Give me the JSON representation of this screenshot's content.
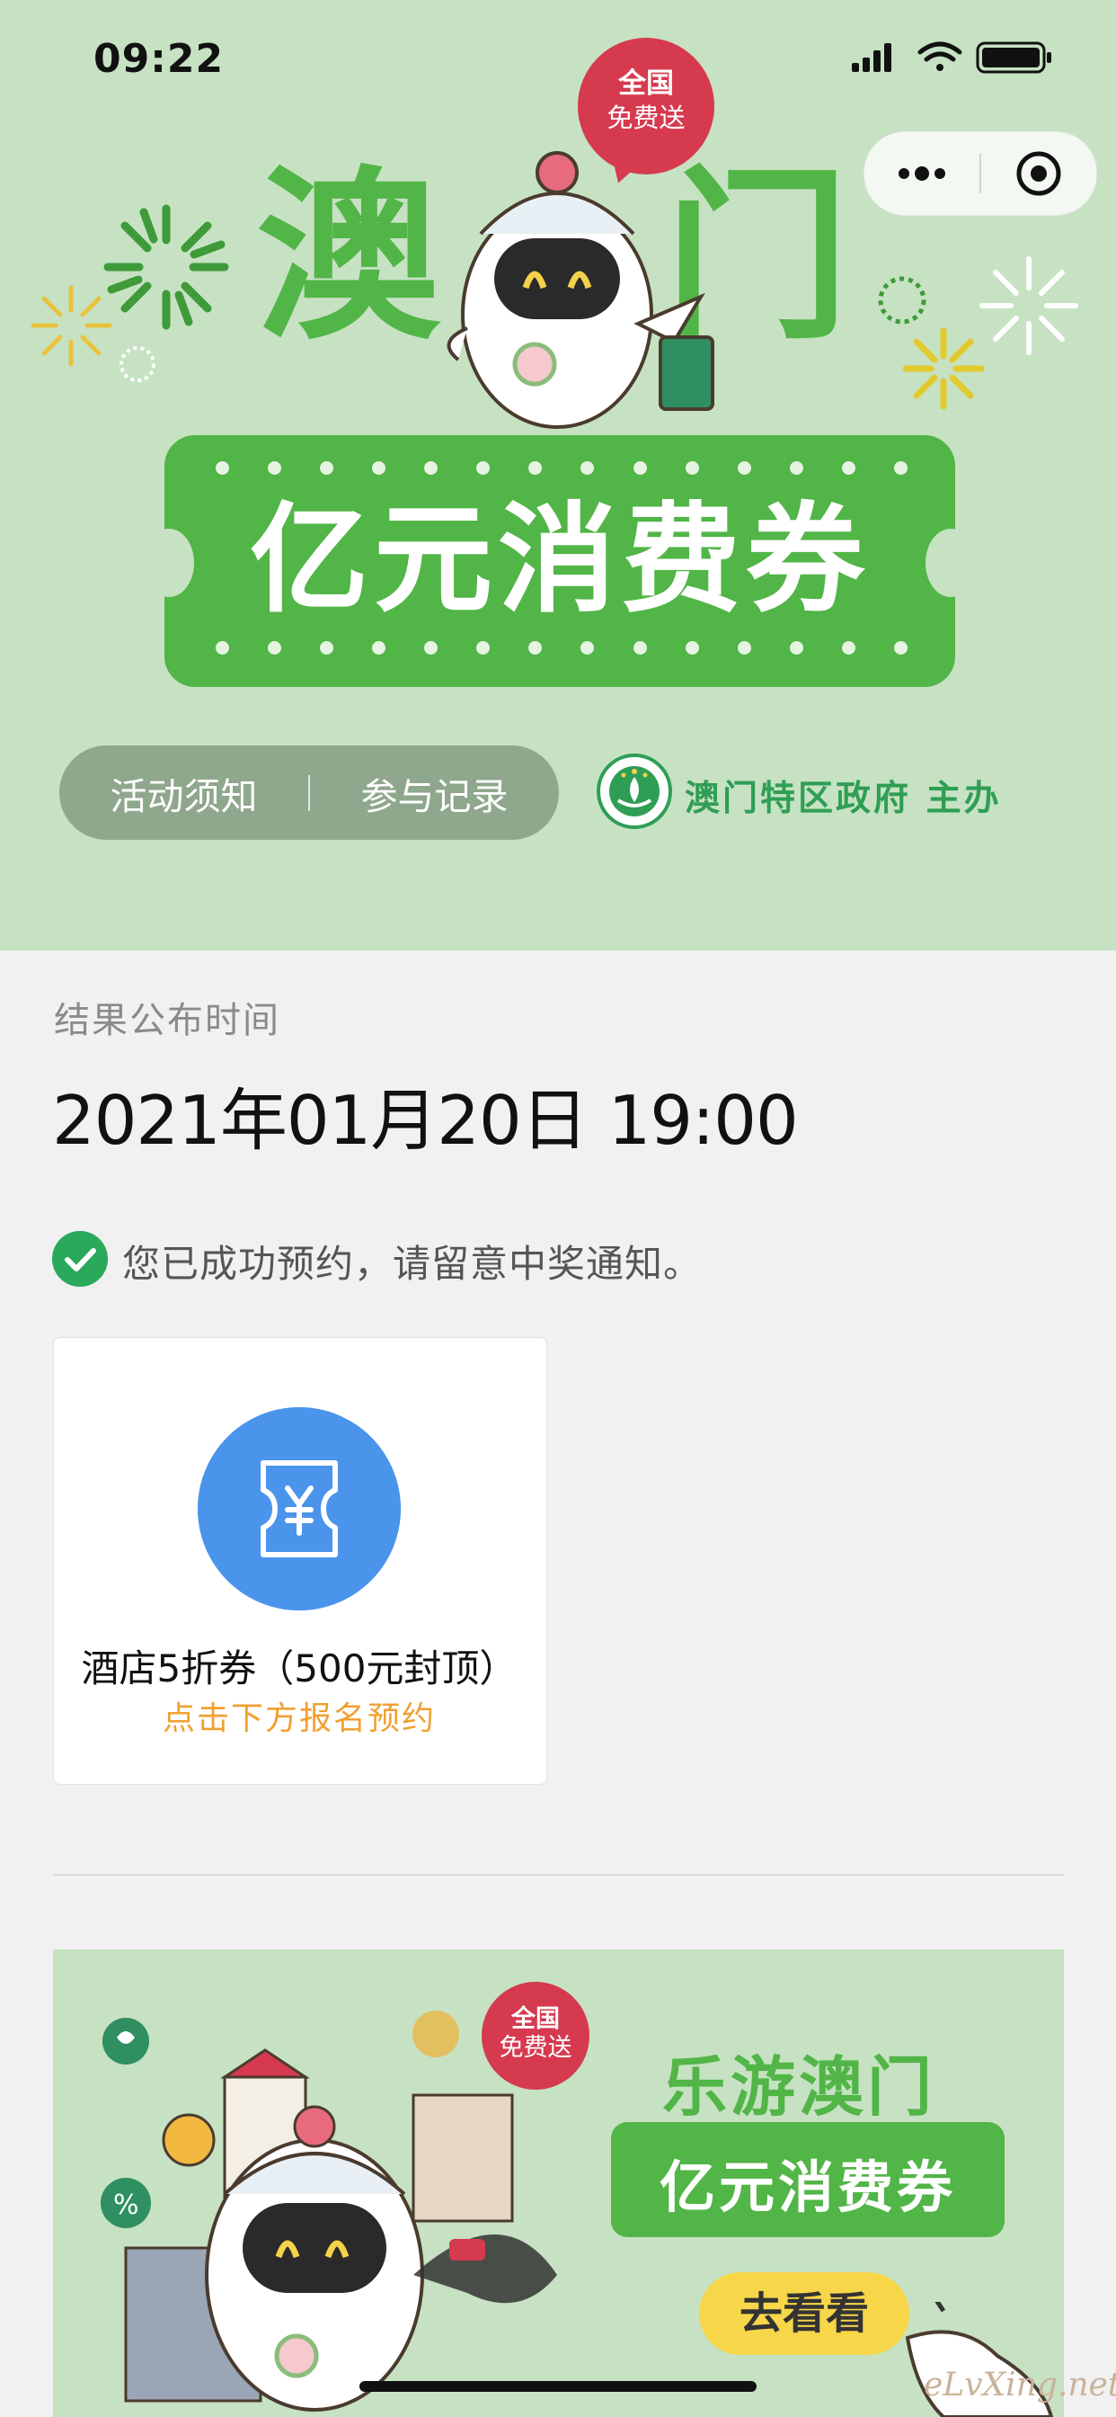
{
  "status_bar": {
    "time": "09:22"
  },
  "hero": {
    "title": "澳门",
    "badge": {
      "line1": "全国",
      "line2": "免费送"
    },
    "ticket_text": "亿元消费券",
    "menu": {
      "left": "活动须知",
      "right": "参与记录"
    },
    "host": "澳门特区政府 主办"
  },
  "result": {
    "label": "结果公布时间",
    "time": "2021年01月20日 19:00",
    "success_message": "您已成功预约，请留意中奖通知。"
  },
  "coupon": {
    "name": "酒店5折券（500元封顶）",
    "hint": "点击下方报名预约"
  },
  "banner": {
    "title": "乐游澳门",
    "ticket_text": "亿元消费券",
    "button": "去看看",
    "badge": {
      "line1": "全国",
      "line2": "免费送"
    }
  },
  "watermark": "eLvXing.net",
  "colors": {
    "hero_bg": "#c6e2c3",
    "brand_green": "#52b547",
    "badge_red": "#d63a4f",
    "coupon_blue": "#4a94ec",
    "hint_orange": "#f0a032",
    "success_green": "#2aa95b"
  },
  "icons": [
    "signal-icon",
    "wifi-icon",
    "battery-icon",
    "more-icon",
    "close-target-icon",
    "macau-emblem-icon",
    "check-icon",
    "ticket-yuan-icon"
  ]
}
